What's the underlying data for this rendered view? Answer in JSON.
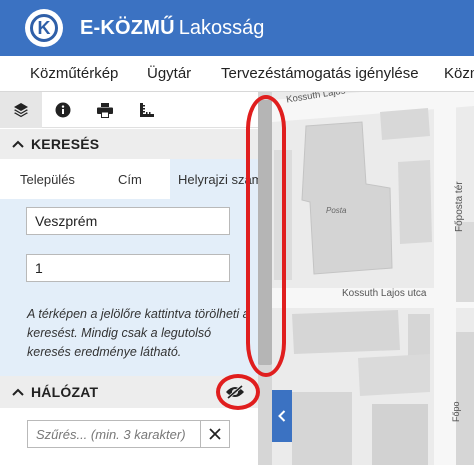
{
  "header": {
    "brand": "E-KÖZMŰ",
    "subtitle": "Lakosság",
    "logo_letter": "K",
    "bg_color": "#3b72c2"
  },
  "menu": {
    "items": [
      {
        "label": "Közműtérkép"
      },
      {
        "label": "Ügytár"
      },
      {
        "label": "Tervezéstámogatás igénylése"
      },
      {
        "label": "Közm"
      }
    ]
  },
  "toolbar": {
    "tools": [
      {
        "icon": "layers-icon",
        "active": true
      },
      {
        "icon": "info-icon",
        "active": false
      },
      {
        "icon": "print-icon",
        "active": false
      },
      {
        "icon": "measure-icon",
        "active": false
      }
    ]
  },
  "search_section": {
    "title": "KERESÉS",
    "tabs": [
      {
        "label": "Település"
      },
      {
        "label": "Cím"
      },
      {
        "label": "Helyrajzi szám",
        "active": true
      }
    ],
    "field_1_value": "Veszprém",
    "field_2_value": "1",
    "hint": "A térképen a jelölőre kattintva törölheti a keresést. Mindig csak a legutolsó keresés eredménye látható.",
    "panel_color": "#e3eef9"
  },
  "network_section": {
    "title": "HÁLÓZAT",
    "visibility_icon": "eye-off-icon",
    "filter_placeholder": "Szűrés... (min. 3 karakter)",
    "clear_icon": "close-icon"
  },
  "map": {
    "labels": {
      "street_top": "Kossuth Lajos",
      "posta": "Posta",
      "street_mid": "Kossuth Lajos utca",
      "square": "Főposta tér",
      "square_bottom": "Főpo"
    },
    "collapse_icon": "chevron-left-icon",
    "accent_color": "#3b72c2"
  },
  "annotations": {
    "color": "#e01e1e"
  }
}
